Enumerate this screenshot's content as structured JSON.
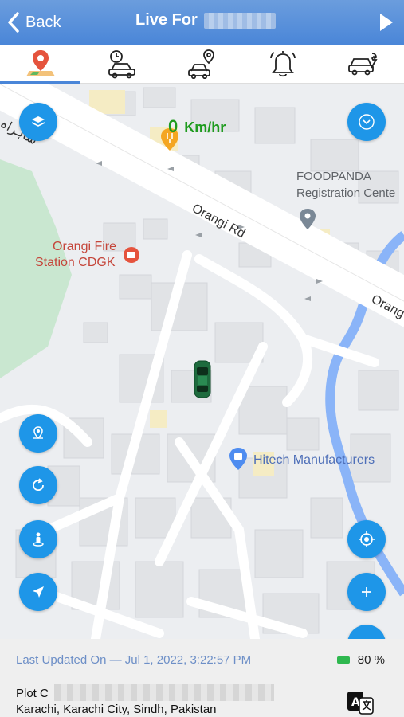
{
  "header": {
    "back_label": "Back",
    "title": "Live For"
  },
  "tabs": [
    {
      "name": "live-location",
      "icon": "map-pin-icon",
      "active": true
    },
    {
      "name": "history",
      "icon": "clock-car-icon",
      "active": false
    },
    {
      "name": "geofence",
      "icon": "car-pin-icon",
      "active": false
    },
    {
      "name": "alerts",
      "icon": "bell-icon",
      "active": false
    },
    {
      "name": "maintenance",
      "icon": "car-wrench-icon",
      "active": false
    }
  ],
  "map": {
    "speed_value": "0",
    "speed_unit": "Km/hr",
    "labels": {
      "foodpanda_line1": "FOODPANDA",
      "foodpanda_line2": "Registration Cente",
      "orangi_fire_line1": "Orangi Fire",
      "orangi_fire_line2": "Station CDGK",
      "hitech": "Hitech Manufacturers",
      "orangi_rd": "Orangi Rd",
      "orang_cut": "Orang",
      "urdu_road": "شاہراہ"
    }
  },
  "controls": {
    "left": [
      "location-pin-icon",
      "refresh-icon",
      "street-view-icon",
      "navigate-icon"
    ],
    "right": [
      "chevron-down-icon",
      "target-icon",
      "plus-icon"
    ]
  },
  "bottom": {
    "last_updated": "Last Updated On — Jul 1, 2022, 3:22:57 PM",
    "battery": "80 %",
    "address_line1": "Plot C",
    "address_line2": "Karachi, Karachi City, Sindh, Pakistan"
  },
  "colors": {
    "header": "#4a86d8",
    "fab": "#1e96e8",
    "speed": "#1e9b1e",
    "battery": "#2fb84f",
    "updated_text": "#6d8fc7",
    "river": "#8ab4f8",
    "park": "#c9e7d0"
  }
}
